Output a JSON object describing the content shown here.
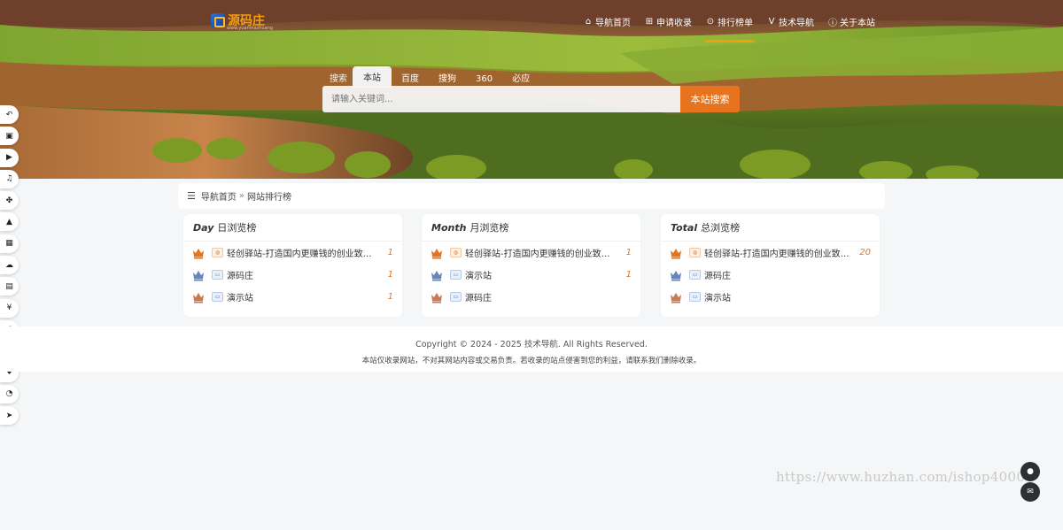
{
  "logo": {
    "name": "源码庄",
    "sub": "www.yuanmazhuang"
  },
  "topnav": [
    {
      "icon": "home-icon",
      "glyph": "⌂",
      "label": "导航首页",
      "active": false
    },
    {
      "icon": "plus-square-icon",
      "glyph": "⊞",
      "label": "申请收录",
      "active": false
    },
    {
      "icon": "ranking-icon",
      "glyph": "⊙",
      "label": "排行榜单",
      "active": true
    },
    {
      "icon": "v-icon",
      "glyph": "V",
      "label": "技术导航",
      "active": false
    },
    {
      "icon": "info-icon",
      "glyph": "ⓘ",
      "label": "关于本站",
      "active": false
    }
  ],
  "search": {
    "tabs": [
      "搜索",
      "本站",
      "百度",
      "搜狗",
      "360",
      "必应"
    ],
    "active_tab": "本站",
    "placeholder": "请输入关键词...",
    "button": "本站搜索"
  },
  "side_menu": [
    "back-icon",
    "shop-icon",
    "video-icon",
    "music-icon",
    "game-icon",
    "education-icon",
    "apps-icon",
    "cloud-icon",
    "document-icon",
    "yen-icon",
    "chart-icon",
    "compass-icon",
    "health-icon",
    "code-icon",
    "send-icon"
  ],
  "breadcrumb": {
    "home": "导航首页",
    "separator": "»",
    "current": "网站排行榜"
  },
  "rankings": [
    {
      "en": "Day",
      "title": "日浏览榜",
      "items": [
        {
          "name": "轻创驿站-打造国内更赚钱的创业致富平台",
          "count": "1",
          "fav": "orange"
        },
        {
          "name": "源码庄",
          "count": "1",
          "fav": "blue"
        },
        {
          "name": "演示站",
          "count": "1",
          "fav": "blue"
        }
      ]
    },
    {
      "en": "Month",
      "title": "月浏览榜",
      "items": [
        {
          "name": "轻创驿站-打造国内更赚钱的创业致富平台",
          "count": "1",
          "fav": "orange"
        },
        {
          "name": "演示站",
          "count": "1",
          "fav": "blue"
        },
        {
          "name": "源码庄",
          "count": "",
          "fav": "blue"
        }
      ]
    },
    {
      "en": "Total",
      "title": "总浏览榜",
      "items": [
        {
          "name": "轻创驿站-打造国内更赚钱的创业致富平...",
          "count": "20",
          "fav": "orange"
        },
        {
          "name": "源码庄",
          "count": "",
          "fav": "blue"
        },
        {
          "name": "演示站",
          "count": "",
          "fav": "blue"
        }
      ]
    }
  ],
  "footer": {
    "copyright": "Copyright © 2024 - 2025 技术导航. All Rights Reserved.",
    "notice": "本站仅收录网站，不对其网站内容或交易负责。若收录的站点侵害到您的利益，请联系我们删除收录。"
  },
  "watermark": "https://www.huzhan.com/ishop4000",
  "colors": {
    "accent": "#e8731e",
    "gold": "#f59e0b"
  }
}
